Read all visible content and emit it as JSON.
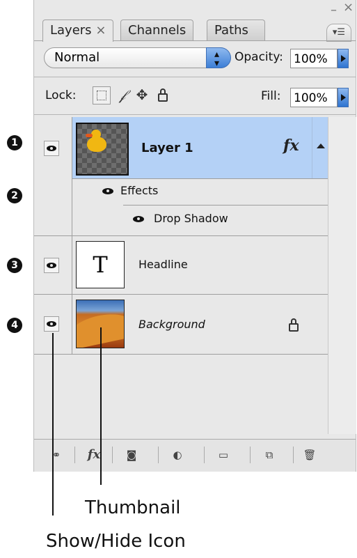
{
  "panel": {
    "window_controls": {
      "minimize": "–",
      "close": "×",
      "menu": "▾☰"
    },
    "tabs": [
      {
        "label": "Layers",
        "close": "×",
        "active": true
      },
      {
        "label": "Channels",
        "active": false
      },
      {
        "label": "Paths",
        "active": false
      }
    ],
    "blend_mode": "Normal",
    "opacity_label": "Opacity:",
    "opacity_value": "100%",
    "lock_label": "Lock:",
    "fill_label": "Fill:",
    "fill_value": "100%"
  },
  "layers": [
    {
      "name": "Layer 1",
      "visible": true,
      "selected": true,
      "fx": "fx",
      "thumbnail": "duck-on-transparent"
    },
    {
      "name": "Headline",
      "visible": true,
      "selected": false,
      "thumbnail": "type-T"
    },
    {
      "name": "Background",
      "visible": true,
      "selected": false,
      "locked": true,
      "thumbnail": "desert-image"
    }
  ],
  "effects": {
    "label": "Effects",
    "items": [
      "Drop Shadow"
    ]
  },
  "bottom_bar": {
    "fx": "fx"
  },
  "badges": [
    "1",
    "2",
    "3",
    "4"
  ],
  "callouts": {
    "thumbnail": "Thumbnail",
    "show_hide": "Show/Hide Icon"
  },
  "colors": {
    "selection": "#b4d1f6",
    "accent": "#3d7fd6"
  }
}
